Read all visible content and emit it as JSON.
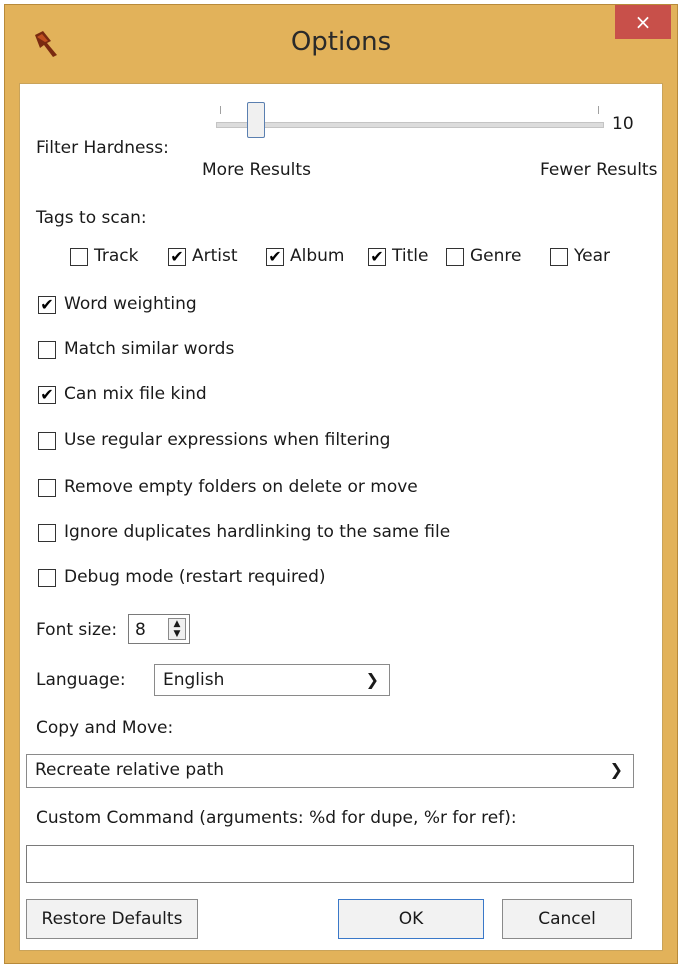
{
  "window": {
    "title": "Options",
    "close_glyph": "×",
    "icon": "app-pointer-icon"
  },
  "filter": {
    "label": "Filter Hardness:",
    "value": "10",
    "left_label": "More Results",
    "right_label": "Fewer Results",
    "slider_fraction": 0.1
  },
  "tags": {
    "label": "Tags to scan:",
    "items": [
      {
        "label": "Track",
        "checked": false
      },
      {
        "label": "Artist",
        "checked": true
      },
      {
        "label": "Album",
        "checked": true
      },
      {
        "label": "Title",
        "checked": true
      },
      {
        "label": "Genre",
        "checked": false
      },
      {
        "label": "Year",
        "checked": false
      }
    ]
  },
  "options": [
    {
      "label": "Word weighting",
      "checked": true
    },
    {
      "label": "Match similar words",
      "checked": false
    },
    {
      "label": "Can mix file kind",
      "checked": true
    },
    {
      "label": "Use regular expressions when filtering",
      "checked": false
    },
    {
      "label": "Remove empty folders on delete or move",
      "checked": false
    },
    {
      "label": "Ignore duplicates hardlinking to the same file",
      "checked": false
    },
    {
      "label": "Debug mode (restart required)",
      "checked": false
    }
  ],
  "font_size": {
    "label": "Font size:",
    "value": "8"
  },
  "language": {
    "label": "Language:",
    "value": "English"
  },
  "copy_move": {
    "label": "Copy and Move:",
    "value": "Recreate relative path"
  },
  "custom_command": {
    "label": "Custom Command (arguments: %d for dupe, %r for ref):",
    "value": ""
  },
  "buttons": {
    "restore": "Restore Defaults",
    "ok": "OK",
    "cancel": "Cancel"
  },
  "check_glyph": "✔"
}
